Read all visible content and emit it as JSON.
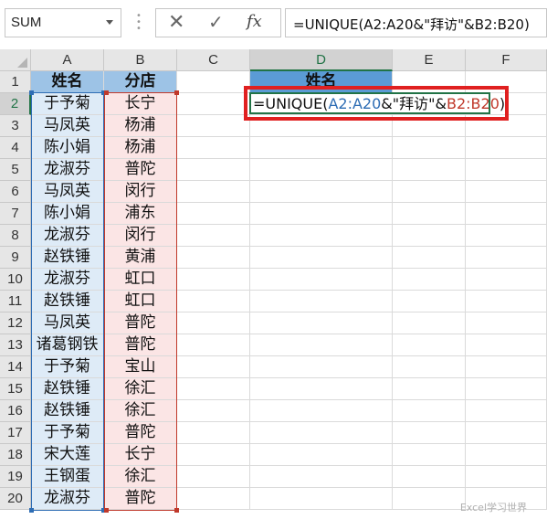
{
  "formula_bar": {
    "name_box": "SUM",
    "cancel_icon": "✕",
    "enter_icon": "✓",
    "fx_label": "fx",
    "formula": "=UNIQUE(A2:A20&\"拜访\"&B2:B20)"
  },
  "columns": [
    "A",
    "B",
    "C",
    "D",
    "E",
    "F"
  ],
  "rows": [
    "1",
    "2",
    "3",
    "4",
    "5",
    "6",
    "7",
    "8",
    "9",
    "10",
    "11",
    "12",
    "13",
    "14",
    "15",
    "16",
    "17",
    "18",
    "19",
    "20"
  ],
  "headers": {
    "A1": "姓名",
    "B1": "分店",
    "D1": "姓名"
  },
  "names": [
    "于予菊",
    "马凤英",
    "陈小娟",
    "龙淑芬",
    "马凤英",
    "陈小娟",
    "龙淑芬",
    "赵铁锤",
    "龙淑芬",
    "赵铁锤",
    "马凤英",
    "诸葛钢铁",
    "于予菊",
    "赵铁锤",
    "赵铁锤",
    "于予菊",
    "宋大莲",
    "王钢蛋",
    "龙淑芬"
  ],
  "stores": [
    "长宁",
    "杨浦",
    "杨浦",
    "普陀",
    "闵行",
    "浦东",
    "闵行",
    "黄浦",
    "虹口",
    "虹口",
    "普陀",
    "普陀",
    "宝山",
    "徐汇",
    "徐汇",
    "普陀",
    "长宁",
    "徐汇",
    "普陀"
  ],
  "editing_cell": {
    "address": "D2",
    "prefix": "=UNIQUE(",
    "ref_a": "A2:A20",
    "middle": "&\"拜访\"&",
    "ref_b": "B2:B20",
    "suffix": ")"
  },
  "colors": {
    "header_blue": "#9dc3e6",
    "ref_a": "#2e6db4",
    "ref_b": "#c0392b",
    "highlight_red": "#e02020",
    "excel_green": "#217346"
  },
  "watermark": "Excel学习世界"
}
